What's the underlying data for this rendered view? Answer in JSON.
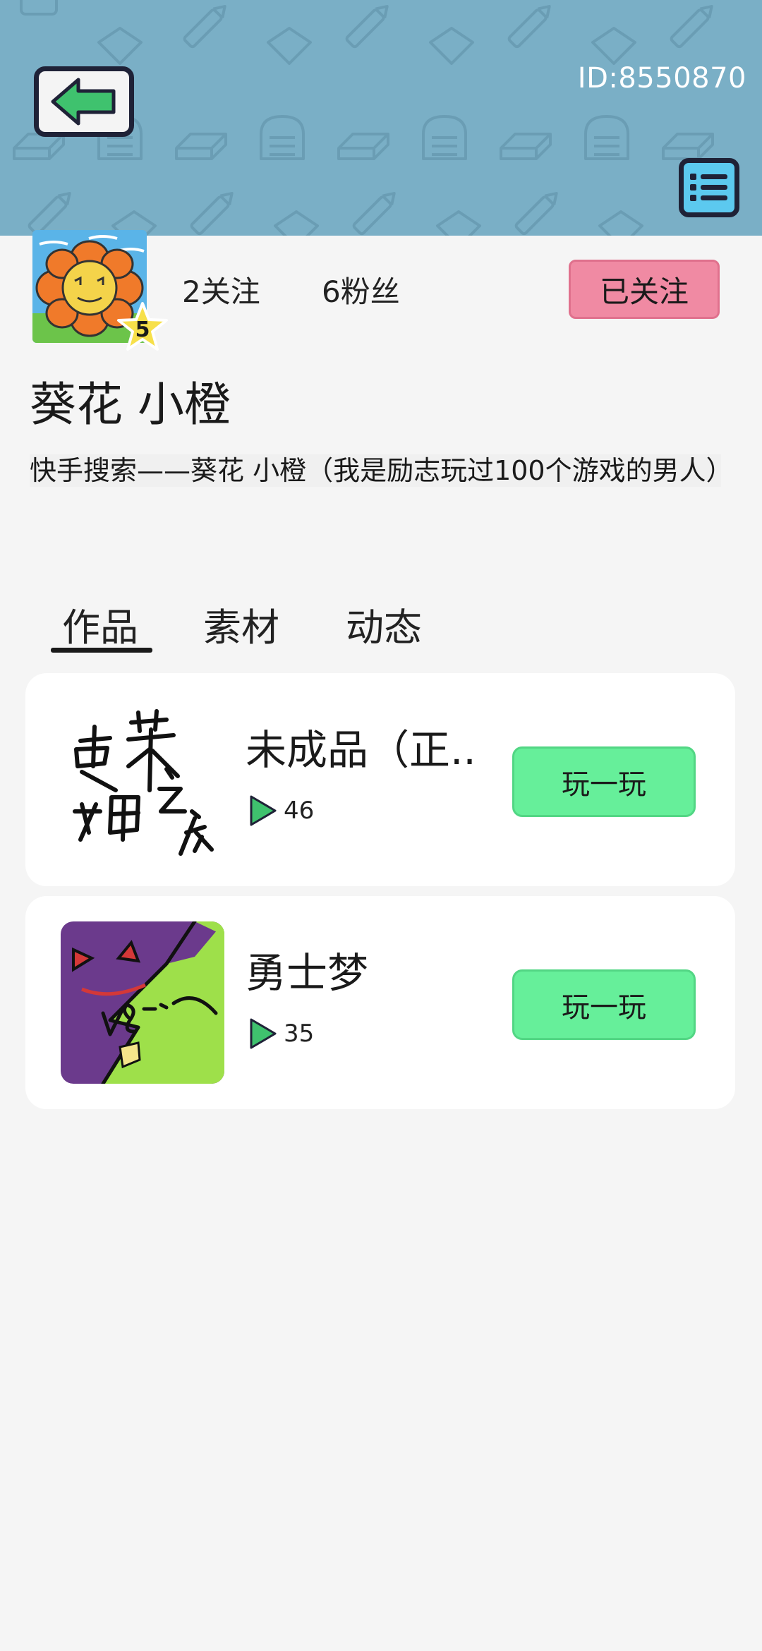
{
  "header": {
    "user_id": "ID:8550870",
    "back_icon": "green-left-arrow-icon",
    "menu_icon": "list-menu-icon"
  },
  "profile": {
    "level": "5",
    "following": "2关注",
    "followers": "6粉丝",
    "follow_button": "已关注",
    "username": "葵花 小橙",
    "bio": "快手搜索——葵花 小橙（我是励志玩过100个游戏的男人）"
  },
  "tabs": [
    {
      "label": "作品",
      "active": true
    },
    {
      "label": "素材",
      "active": false
    },
    {
      "label": "动态",
      "active": false
    }
  ],
  "works": [
    {
      "title": "未成品（正..",
      "plays": "46",
      "play_button": "玩一玩"
    },
    {
      "title": "勇士梦",
      "plays": "35",
      "play_button": "玩一玩"
    }
  ],
  "colors": {
    "header_bg": "#7aafc6",
    "follow_button": "#f08aa3",
    "play_button": "#66ef9a",
    "menu_button": "#5cc9ef",
    "back_arrow": "#3fc26e"
  }
}
